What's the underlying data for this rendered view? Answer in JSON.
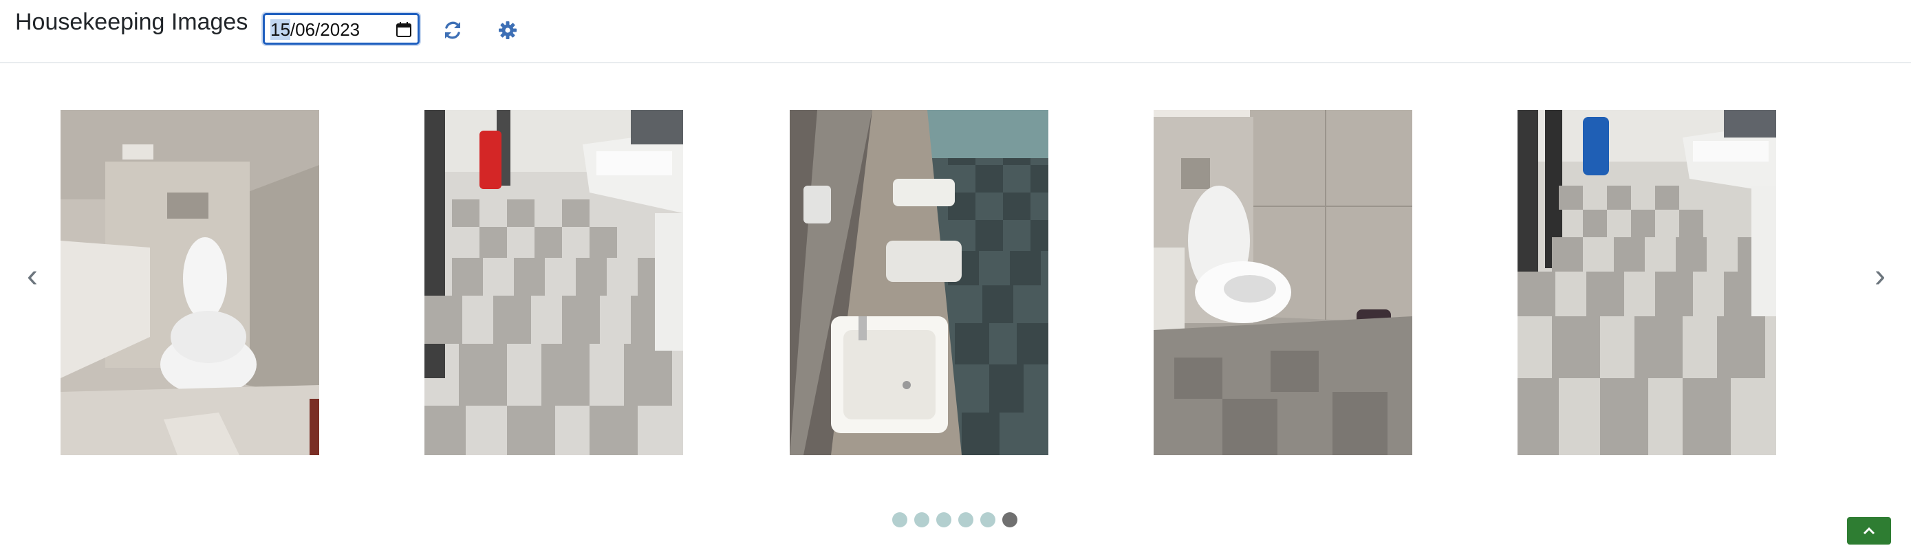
{
  "header": {
    "title": "Housekeeping Images",
    "date_value": "15/06/2023",
    "date_day": "15",
    "date_rest": "/06/2023",
    "refresh_icon": "refresh-icon",
    "settings_icon": "gear-icon"
  },
  "carousel": {
    "prev_label": "‹",
    "next_label": "›",
    "dots_total": 6,
    "active_dot": 6,
    "slides": [
      {
        "subject": "toilet-stall"
      },
      {
        "subject": "washroom-floor-red-bin"
      },
      {
        "subject": "sink-counter"
      },
      {
        "subject": "toilet-with-bin"
      },
      {
        "subject": "washroom-floor-blue-bin"
      }
    ]
  },
  "colors": {
    "accent": "#3d6fb5",
    "dot_inactive": "#b3cfcf",
    "dot_active": "#707070",
    "date_border": "#1f5fbf",
    "action_button": "#2e7d32"
  }
}
